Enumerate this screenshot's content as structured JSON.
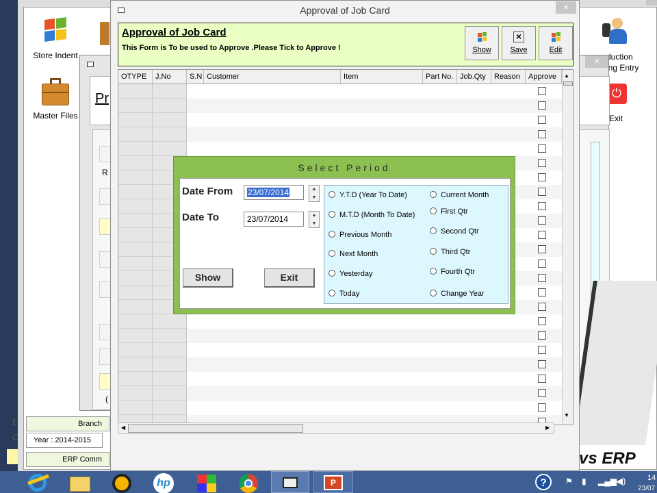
{
  "desktop": {
    "icons": [
      {
        "label": "Store Indent",
        "icon": "windows-flag-icon"
      },
      {
        "label": "Master Files",
        "icon": "briefcase-icon"
      },
      {
        "label": "duction",
        "icon": "users-icon"
      },
      {
        "label": "ing Entry",
        "icon": ""
      },
      {
        "label": "Exit",
        "icon": "power-icon"
      }
    ],
    "bg_labels": {
      "pr": "Pr",
      "r": "R",
      "branch": "Branch",
      "year": "Year : 2014-2015",
      "erp_comm": "ERP Comm",
      "e": "E",
      "c": "C",
      "brand": "vs ERP"
    }
  },
  "window": {
    "title": "Approval of Job Card",
    "close_label": "×",
    "heading": "Approval of Job Card",
    "subtitle": "This Form is To be used to Approve .Please Tick to Approve !",
    "toolbar": {
      "show": "Show",
      "save": "Save",
      "edit": "Edit"
    }
  },
  "grid": {
    "columns": [
      "OTYPE",
      "J.No",
      "S.N",
      "Customer",
      "Item",
      "Part No.",
      "Job.Qty",
      "Reason",
      "Approve"
    ],
    "row_count": 24
  },
  "dialog": {
    "title": "Select Period",
    "date_from_label": "Date From",
    "date_to_label": "Date To",
    "date_from_value": "23/07/2014",
    "date_to_value": "23/07/2014",
    "show_button": "Show",
    "exit_button": "Exit",
    "options_left": [
      "Y.T.D (Year To Date)",
      "M.T.D (Month To Date)",
      "Previous Month",
      "Next Month",
      "Yesterday",
      "Today"
    ],
    "options_right": [
      "Current Month",
      "First Qtr",
      "Second Qtr",
      "Third Qtr",
      "Fourth Qtr",
      "Change Year"
    ]
  },
  "taskbar": {
    "apps": [
      "ie-icon",
      "file-explorer-icon",
      "media-player-icon",
      "hp-icon",
      "puzzle-app-icon",
      "chrome-icon",
      "window-app-icon",
      "powerpoint-icon"
    ],
    "clock_time": "14",
    "clock_date": "23/07"
  },
  "colors": {
    "header_bg": "#eaffc4",
    "dialog_green": "#8cc152",
    "radio_bg": "#dcf8fe",
    "taskbar": "#3d5f94"
  }
}
